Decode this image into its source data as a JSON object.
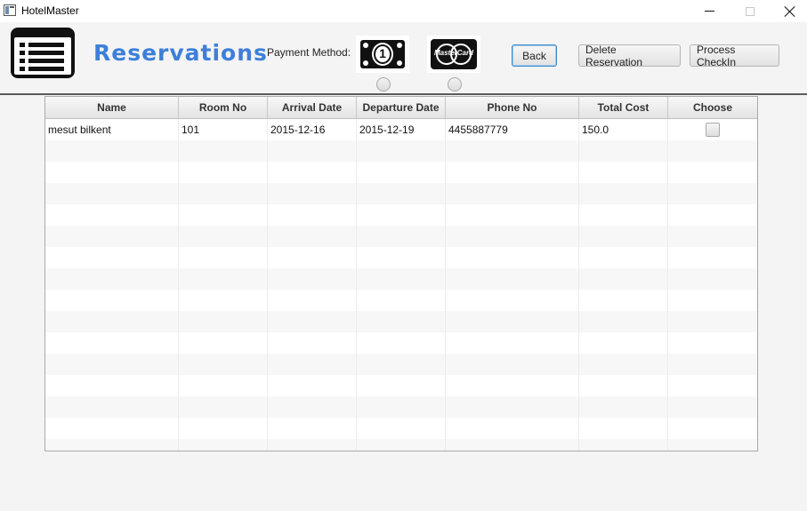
{
  "window": {
    "title": "HotelMaster"
  },
  "header": {
    "page_title": "Reservations",
    "payment_label": "Payment Method:",
    "payment_options": [
      {
        "name": "cash",
        "icon": "cash-bill-icon",
        "glyph": "1"
      },
      {
        "name": "mastercard",
        "icon": "mastercard-icon",
        "glyph": "MasterCard"
      }
    ],
    "buttons": {
      "back": "Back",
      "delete": "Delete Reservation",
      "checkin": "Process CheckIn"
    }
  },
  "table": {
    "columns": [
      "Name",
      "Room No",
      "Arrival Date",
      "Departure Date",
      "Phone No",
      "Total Cost",
      "Choose"
    ],
    "rows": [
      {
        "name": "mesut bilkent",
        "room": "101",
        "arrival": "2015-12-16",
        "departure": "2015-12-19",
        "phone": "4455887779",
        "cost": "150.0",
        "chosen": false
      }
    ]
  },
  "colors": {
    "title_blue": "#3d7fd9",
    "focus_blue": "#3c8ccb"
  }
}
